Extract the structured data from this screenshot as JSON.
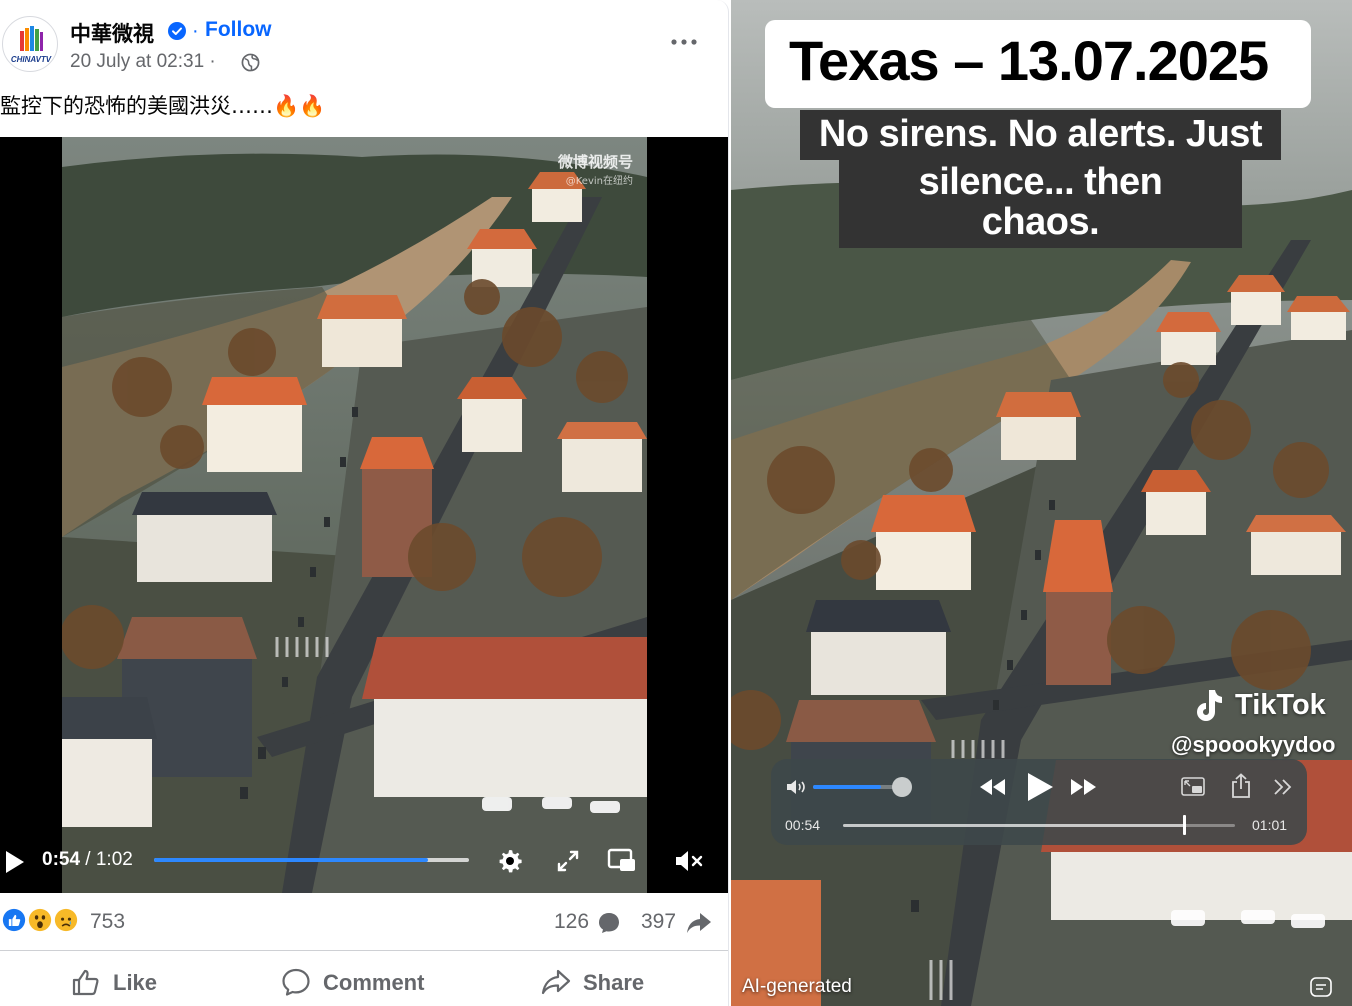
{
  "facebook_post": {
    "page_name": "中華微視",
    "follow_separator": "·",
    "follow_label": "Follow",
    "date": "20 July at 02:31 ·",
    "caption": "監控下的恐怖的美國洪災……🔥🔥",
    "video": {
      "watermark": "微博视频号",
      "watermark_sub": "@Kevin在纽约",
      "current_time": "0:54",
      "duration": " / 1:02",
      "progress": 0.87
    },
    "reactions": {
      "count": "753",
      "types": [
        "like",
        "wow",
        "sad"
      ],
      "comments": "126",
      "shares": "397"
    },
    "actions": {
      "like": "Like",
      "comment": "Comment",
      "share": "Share"
    },
    "colors": {
      "accent": "#0866ff",
      "text_secondary": "#65676b"
    }
  },
  "tiktok_video": {
    "title": "Texas – 13.07.2025",
    "subtitle_line1": "No sirens. No alerts. Just",
    "subtitle_line2": "silence... then chaos.",
    "brand": "TikTok",
    "handle": "@spoookyydoo",
    "player": {
      "current_time": "00:54",
      "end_time": "01:01",
      "progress": 0.87,
      "volume": 0.75
    },
    "ai_label": "AI-generated"
  }
}
